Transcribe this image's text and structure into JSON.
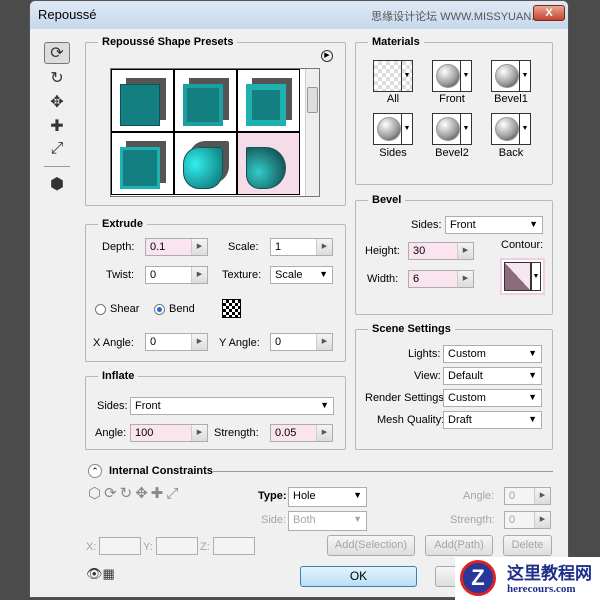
{
  "window": {
    "title": "Repoussé",
    "close": "X",
    "watermark_top": "思缘设计论坛 WWW.MISSYUAN.COM"
  },
  "presets": {
    "title": "Repoussé Shape Presets"
  },
  "materials": {
    "title": "Materials",
    "items": [
      "All",
      "Front",
      "Bevel1",
      "Sides",
      "Bevel2",
      "Back"
    ]
  },
  "extrude": {
    "title": "Extrude",
    "depth_label": "Depth:",
    "depth": "0.1",
    "scale_label": "Scale:",
    "scale": "1",
    "twist_label": "Twist:",
    "twist": "0",
    "texture_label": "Texture:",
    "texture": "Scale",
    "shear": "Shear",
    "bend": "Bend",
    "xangle_label": "X Angle:",
    "xangle": "0",
    "yangle_label": "Y Angle:",
    "yangle": "0"
  },
  "inflate": {
    "title": "Inflate",
    "sides_label": "Sides:",
    "sides": "Front",
    "angle_label": "Angle:",
    "angle": "100",
    "strength_label": "Strength:",
    "strength": "0.05"
  },
  "bevel": {
    "title": "Bevel",
    "sides_label": "Sides:",
    "sides": "Front",
    "height_label": "Height:",
    "height": "30",
    "width_label": "Width:",
    "width": "6",
    "contour_label": "Contour:"
  },
  "scene": {
    "title": "Scene Settings",
    "lights_label": "Lights:",
    "lights": "Custom",
    "view_label": "View:",
    "view": "Default",
    "render_label": "Render Settings:",
    "render": "Custom",
    "mesh_label": "Mesh Quality:",
    "mesh": "Draft"
  },
  "constraints": {
    "title": "Internal Constraints",
    "type_label": "Type:",
    "type": "Hole",
    "side_label": "Side:",
    "side": "Both",
    "angle_label": "Angle:",
    "angle": "0",
    "strength_label": "Strength:",
    "strength": "0",
    "x": "X:",
    "y": "Y:",
    "z": "Z:",
    "add_selection": "Add(Selection)",
    "add_path": "Add(Path)",
    "delete": "Delete"
  },
  "footer": {
    "ok": "OK"
  },
  "watermark": {
    "cn": "这里教程网",
    "url": "herecours.com"
  }
}
